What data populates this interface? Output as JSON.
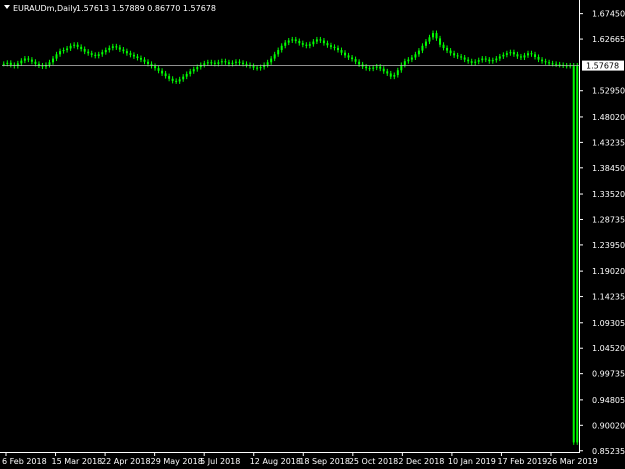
{
  "header": {
    "symbol": "EURAUDm,Daily",
    "ohlc": "1.57613 1.57889 0.86770 1.57678"
  },
  "colors": {
    "background": "#000000",
    "bull": "#00ff00",
    "bear": "#00ff00",
    "axis": "#ffffff",
    "price_line": "#c0c0c0",
    "price_label_bg": "#ffffff",
    "price_label_text": "#000000"
  },
  "chart_data": {
    "type": "line",
    "symbol": "EURAUDm",
    "timeframe": "Daily",
    "last_price": "1.57678",
    "ylim": [
      0.85,
      1.6945
    ],
    "yticks": [
      "1.67450",
      "1.62665",
      "1.57678",
      "1.52950",
      "1.48020",
      "1.43235",
      "1.38450",
      "1.33520",
      "1.28735",
      "1.23950",
      "1.19020",
      "1.14235",
      "1.09305",
      "1.04520",
      "0.99735",
      "0.94805",
      "0.90020",
      "0.85235"
    ],
    "xticks": [
      "6 Feb 2018",
      "15 Mar 2018",
      "22 Apr 2018",
      "29 May 2018",
      "5 Jul 2018",
      "12 Aug 2018",
      "18 Sep 2018",
      "25 Oct 2018",
      "2 Dec 2018",
      "10 Jan 2019",
      "17 Feb 2019",
      "26 Mar 2019"
    ],
    "grid": false,
    "legend": "none",
    "series": [
      {
        "values": [
          1.58,
          1.582,
          1.578,
          1.576,
          1.581,
          1.586,
          1.59,
          1.588,
          1.584,
          1.58,
          1.577,
          1.575,
          1.578,
          1.583,
          1.59,
          1.598,
          1.604,
          1.606,
          1.609,
          1.614,
          1.616,
          1.612,
          1.608,
          1.603,
          1.6,
          1.597,
          1.595,
          1.598,
          1.602,
          1.606,
          1.61,
          1.613,
          1.611,
          1.607,
          1.604,
          1.6,
          1.597,
          1.594,
          1.591,
          1.588,
          1.584,
          1.58,
          1.576,
          1.572,
          1.567,
          1.562,
          1.557,
          1.552,
          1.548,
          1.547,
          1.551,
          1.556,
          1.561,
          1.566,
          1.57,
          1.574,
          1.578,
          1.581,
          1.583,
          1.582,
          1.58,
          1.583,
          1.585,
          1.583,
          1.58,
          1.582,
          1.584,
          1.582,
          1.58,
          1.578,
          1.576,
          1.573,
          1.572,
          1.574,
          1.578,
          1.583,
          1.59,
          1.598,
          1.606,
          1.614,
          1.62,
          1.624,
          1.626,
          1.623,
          1.619,
          1.616,
          1.614,
          1.617,
          1.622,
          1.626,
          1.624,
          1.619,
          1.615,
          1.612,
          1.61,
          1.606,
          1.601,
          1.596,
          1.592,
          1.589,
          1.584,
          1.579,
          1.575,
          1.572,
          1.571,
          1.573,
          1.575,
          1.571,
          1.566,
          1.562,
          1.556,
          1.559,
          1.568,
          1.578,
          1.585,
          1.588,
          1.592,
          1.598,
          1.605,
          1.614,
          1.622,
          1.63,
          1.638,
          1.628,
          1.616,
          1.61,
          1.605,
          1.6,
          1.596,
          1.594,
          1.592,
          1.588,
          1.585,
          1.582,
          1.584,
          1.587,
          1.59,
          1.588,
          1.585,
          1.587,
          1.59,
          1.594,
          1.597,
          1.6,
          1.602,
          1.598,
          1.594,
          1.592,
          1.596,
          1.6,
          1.598,
          1.593,
          1.588,
          1.585,
          1.583,
          1.581,
          1.58,
          1.579,
          1.578,
          1.577,
          1.576,
          1.577,
          0.868,
          1.577
        ]
      }
    ]
  }
}
